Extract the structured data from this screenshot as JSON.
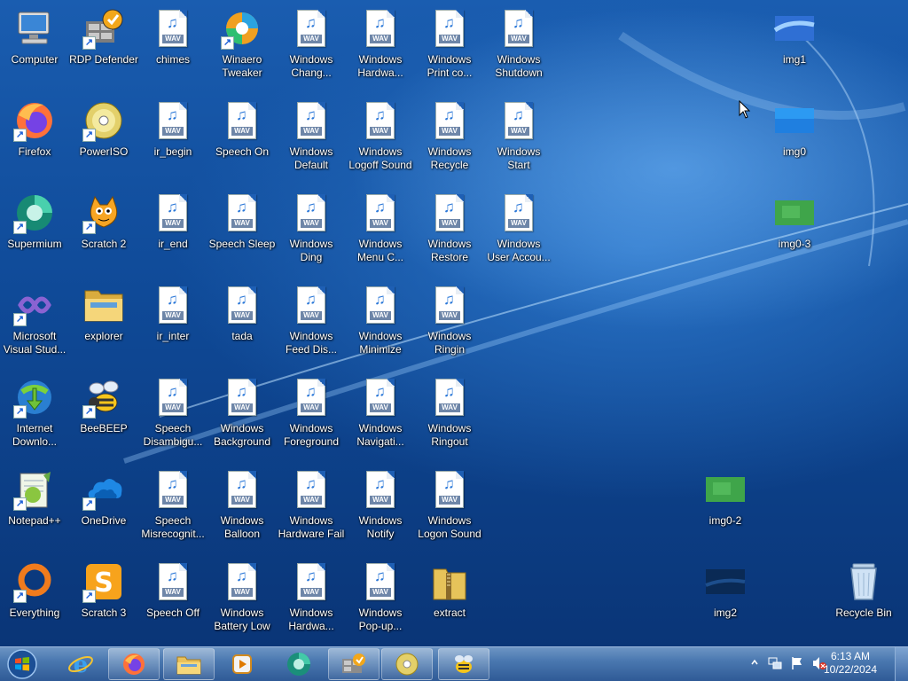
{
  "desktop": {
    "icons": [
      {
        "label": "Computer",
        "kind": "computer",
        "shortcut": false
      },
      {
        "label": "RDP Defender",
        "kind": "rdp",
        "shortcut": true
      },
      {
        "label": "chimes",
        "kind": "wav"
      },
      {
        "label": "Winaero\nTweaker",
        "kind": "winaero",
        "shortcut": true
      },
      {
        "label": "Windows\nChang...",
        "kind": "wav"
      },
      {
        "label": "Windows\nHardwa...",
        "kind": "wav"
      },
      {
        "label": "Windows\nPrint co...",
        "kind": "wav"
      },
      {
        "label": "Windows\nShutdown",
        "kind": "wav"
      },
      {
        "label": "Firefox",
        "kind": "firefox",
        "shortcut": true
      },
      {
        "label": "PowerISO",
        "kind": "poweriso",
        "shortcut": true
      },
      {
        "label": "ir_begin",
        "kind": "wav"
      },
      {
        "label": "Speech On",
        "kind": "wav"
      },
      {
        "label": "Windows\nDefault",
        "kind": "wav"
      },
      {
        "label": "Windows\nLogoff Sound",
        "kind": "wav"
      },
      {
        "label": "Windows\nRecycle",
        "kind": "wav"
      },
      {
        "label": "Windows\nStart",
        "kind": "wav"
      },
      {
        "label": "Supermium",
        "kind": "supermium",
        "shortcut": true
      },
      {
        "label": "Scratch 2",
        "kind": "scratch2",
        "shortcut": true
      },
      {
        "label": "ir_end",
        "kind": "wav"
      },
      {
        "label": "Speech Sleep",
        "kind": "wav"
      },
      {
        "label": "Windows\nDing",
        "kind": "wav"
      },
      {
        "label": "Windows\nMenu C...",
        "kind": "wav"
      },
      {
        "label": "Windows\nRestore",
        "kind": "wav"
      },
      {
        "label": "Windows\nUser Accou...",
        "kind": "wav"
      },
      {
        "label": "Microsoft\nVisual Stud...",
        "kind": "vs",
        "shortcut": true
      },
      {
        "label": "explorer",
        "kind": "folder"
      },
      {
        "label": "ir_inter",
        "kind": "wav"
      },
      {
        "label": "tada",
        "kind": "wav"
      },
      {
        "label": "Windows\nFeed Dis...",
        "kind": "wav"
      },
      {
        "label": "Windows\nMinimize",
        "kind": "wav"
      },
      {
        "label": "Windows\nRingin",
        "kind": "wav"
      },
      {
        "label": "Internet\nDownlo...",
        "kind": "idm",
        "shortcut": true
      },
      {
        "label": "BeeBEEP",
        "kind": "bee",
        "shortcut": true
      },
      {
        "label": "Speech\nDisambigu...",
        "kind": "wav"
      },
      {
        "label": "Windows\nBackground",
        "kind": "wav"
      },
      {
        "label": "Windows\nForeground",
        "kind": "wav"
      },
      {
        "label": "Windows\nNavigati...",
        "kind": "wav"
      },
      {
        "label": "Windows\nRingout",
        "kind": "wav"
      },
      {
        "label": "Notepad++",
        "kind": "notepad",
        "shortcut": true
      },
      {
        "label": "OneDrive",
        "kind": "onedrive",
        "shortcut": true
      },
      {
        "label": "Speech\nMisrecognit...",
        "kind": "wav"
      },
      {
        "label": "Windows\nBalloon",
        "kind": "wav"
      },
      {
        "label": "Windows\nHardware Fail",
        "kind": "wav"
      },
      {
        "label": "Windows\nNotify",
        "kind": "wav"
      },
      {
        "label": "Windows\nLogon Sound",
        "kind": "wav"
      },
      {
        "label": "Everything",
        "kind": "everything",
        "shortcut": true
      },
      {
        "label": "Scratch 3",
        "kind": "scratch3",
        "shortcut": true
      },
      {
        "label": "Speech Off",
        "kind": "wav"
      },
      {
        "label": "Windows\nBattery Low",
        "kind": "wav"
      },
      {
        "label": "Windows\nHardwa...",
        "kind": "wav"
      },
      {
        "label": "Windows\nPop-up...",
        "kind": "wav"
      },
      {
        "label": "extract",
        "kind": "zip"
      },
      {
        "label": "img1",
        "kind": "img-blue"
      },
      {
        "label": "img0",
        "kind": "img-blue2"
      },
      {
        "label": "img0-3",
        "kind": "img-green"
      },
      {
        "label": "img0-2",
        "kind": "img-green"
      },
      {
        "label": "img2",
        "kind": "img-dark"
      },
      {
        "label": "Recycle Bin",
        "kind": "recycle"
      }
    ],
    "wav_tag": "WAV"
  },
  "taskbar": {
    "pinned": [
      "start",
      "ie",
      "firefox",
      "explorer",
      "media-player",
      "supermium",
      "rdp-defender",
      "poweriso",
      "beebeep"
    ],
    "clock_time": "6:13 AM",
    "clock_date": "10/22/2024",
    "tray_icons": [
      "show-hidden-icon",
      "network-icon",
      "action-center-flag-icon",
      "volume-muted-icon"
    ]
  }
}
